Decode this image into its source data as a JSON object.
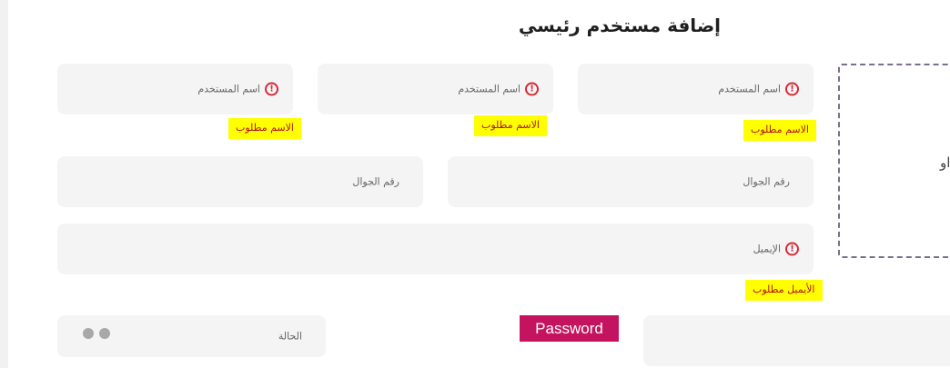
{
  "page": {
    "title": "إضافة مستخدم رئيسي"
  },
  "name_fields": [
    {
      "placeholder": "اسم المستخدم",
      "error": "الاسم مطلوب"
    },
    {
      "placeholder": "اسم المستخدم",
      "error": "الاسم مطلوب"
    },
    {
      "placeholder": "اسم المستخدم",
      "error": "الاسم مطلوب"
    }
  ],
  "phone_fields": [
    {
      "placeholder": "رقم الجوال"
    },
    {
      "placeholder": "رقم الجوال"
    }
  ],
  "email_field": {
    "placeholder": "الإيميل",
    "error": "الأيميل مطلوب"
  },
  "status_field": {
    "placeholder": "الحالة"
  },
  "password": {
    "label": "Password"
  },
  "upload": {
    "text": "نا او"
  },
  "colors": {
    "error_highlight": "#ffff00",
    "error_text": "#b5121b",
    "error_icon": "#d62b38",
    "password_badge": "#c4145f"
  },
  "icons": {
    "error": "error-circle-icon",
    "toggle": "toggle-dots-icon"
  }
}
